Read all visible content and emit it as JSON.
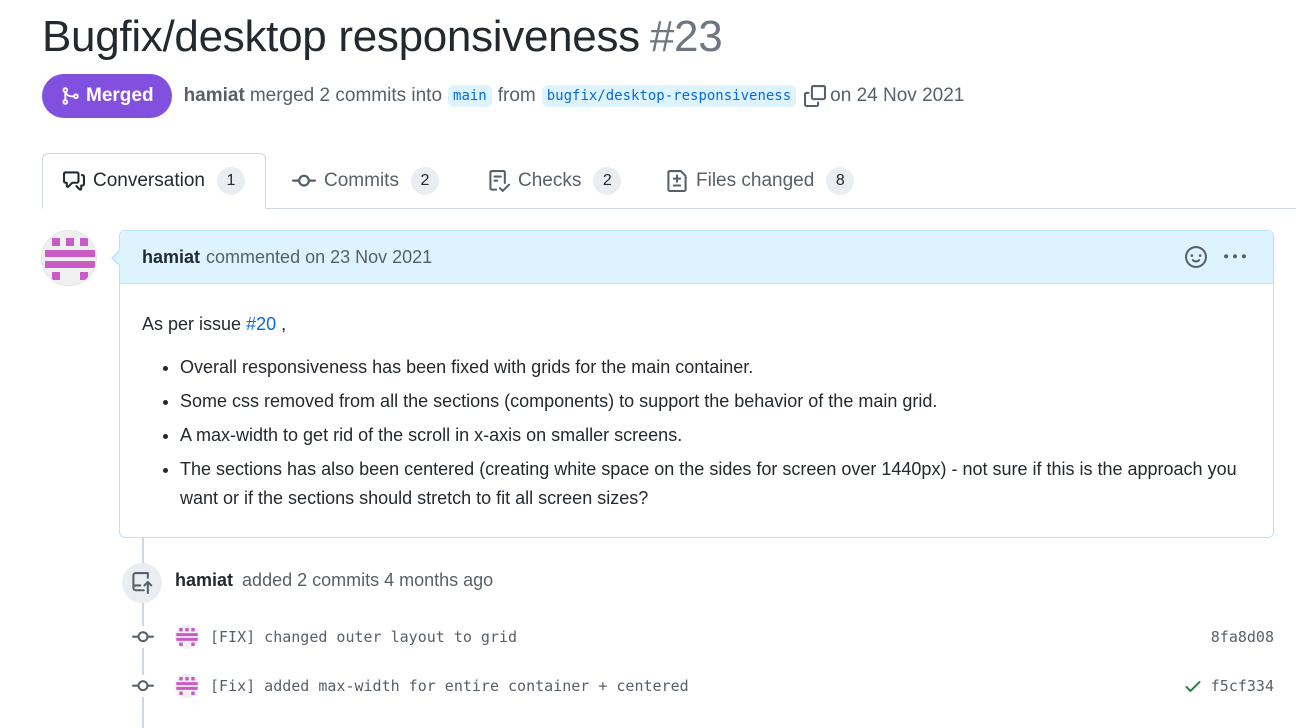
{
  "pr": {
    "title": "Bugfix/desktop responsiveness",
    "number": "#23",
    "state": "Merged",
    "author": "hamiat",
    "merged_text": "merged 2 commits into",
    "base_branch": "main",
    "from_text": "from",
    "head_branch": "bugfix/desktop-responsiveness",
    "date_text": "on 24 Nov 2021"
  },
  "tabs": [
    {
      "label": "Conversation",
      "count": "1",
      "icon": "comment-discussion-icon"
    },
    {
      "label": "Commits",
      "count": "2",
      "icon": "git-commit-icon"
    },
    {
      "label": "Checks",
      "count": "2",
      "icon": "checklist-icon"
    },
    {
      "label": "Files changed",
      "count": "8",
      "icon": "file-diff-icon"
    }
  ],
  "comment": {
    "author": "hamiat",
    "meta": "commented on 23 Nov 2021",
    "intro_prefix": "As per issue",
    "issue_link": "#20",
    "intro_suffix": ",",
    "bullets": [
      "Overall responsiveness has been fixed with grids for the main container.",
      "Some css removed from all the sections (components) to support the behavior of the main grid.",
      "A max-width to get rid of the scroll in x-axis on smaller screens.",
      "The sections has also been centered (creating white space on the sides for screen over 1440px) - not sure if this is the approach you want or if the sections should stretch to fit all screen sizes?"
    ]
  },
  "event": {
    "author": "hamiat",
    "text": "added 2 commits 4 months ago"
  },
  "commits": [
    {
      "message": "[FIX] changed outer layout to grid",
      "sha": "8fa8d08",
      "status": ""
    },
    {
      "message": "[Fix] added max-width for entire container + centered",
      "sha": "f5cf334",
      "status": "success"
    }
  ],
  "colors": {
    "merged": "#8250df",
    "link": "#0969da",
    "header_bg": "#ddf4ff",
    "avatar_identicon": "#c85bc5",
    "success": "#1a7f37"
  }
}
